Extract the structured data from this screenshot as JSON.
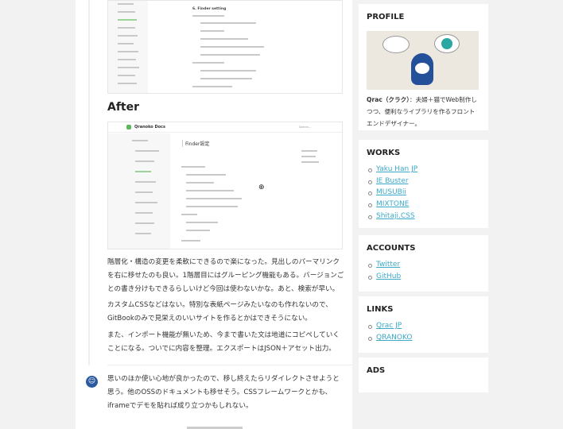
{
  "article": {
    "before_heading": "6. Finder setting",
    "after_heading": "After",
    "after_shot": {
      "app_name": "Qranoko Docs",
      "search_placeholder": "Search...",
      "page_title": "Finder設定"
    },
    "paragraphs": [
      "階層化・構造の変更を柔軟にできるので楽になった。見出しのパーマリンクを右に移せたのも良い。1階層目にはグルーピング機能もある。バージョンごとの書き分けもできるらしいけど今回は使わないかな。あと、検索が早い。",
      "カスタムCSSなどはない。特別な表紙ページみたいなのも作れないので、GitBookのみで見栄えのいいサイトを作るとかはできそうにない。",
      "また、インポート機能が無いため、今まで書いた文は地道にコピペしていくことになる。ついでに内容を整理。エクスポートはJSON＋アセット出力。"
    ],
    "comment": "思いのほか使い心地が良かったので、移し終えたらリダイレクトさせようと思う。他のOSSのドキュメントも移せそう。CSSフレームワークとかも、iframeでデモを貼れば成り立つかもしれない。"
  },
  "sidebar": {
    "profile": {
      "title": "PROFILE",
      "name": "Qrac（クラク）",
      "bio": "：夫婦＋猫でWeb制作しつつ、便利なライブラリを作るフロントエンドデザイナー。"
    },
    "works": {
      "title": "WORKS",
      "items": [
        "Yaku Han JP",
        "IE Buster",
        "MUSUBii",
        "MIXTONE",
        "Shitaji.CSS"
      ]
    },
    "accounts": {
      "title": "ACCOUNTS",
      "items": [
        "Twitter",
        "GitHub"
      ]
    },
    "links": {
      "title": "LINKS",
      "items": [
        "Qrac JP",
        "QRANOKO"
      ]
    },
    "ads": {
      "title": "ADS"
    }
  },
  "colors": {
    "link": "#3ba9c9",
    "accent_green": "#5cb85c"
  }
}
